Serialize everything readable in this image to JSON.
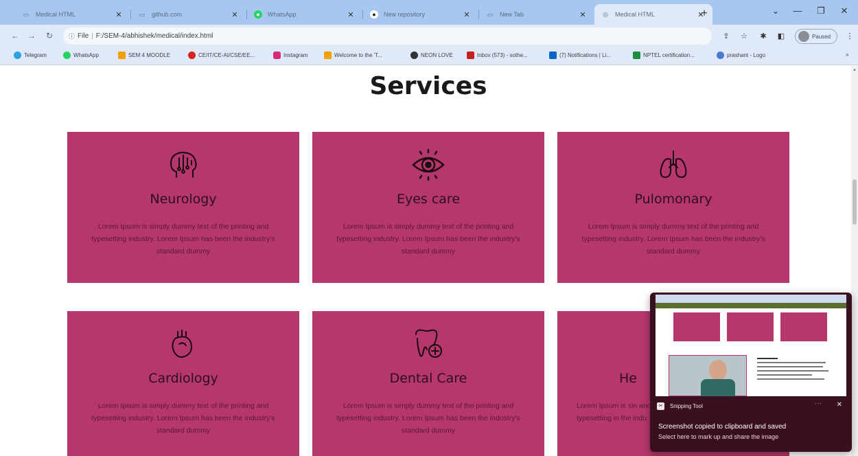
{
  "browser": {
    "tabs": [
      {
        "title": "Medical HTML",
        "favicon": "page-icon",
        "active": false
      },
      {
        "title": "github.com",
        "favicon": "page-icon",
        "active": false
      },
      {
        "title": "WhatsApp",
        "favicon": "whatsapp-icon",
        "active": false
      },
      {
        "title": "New repository",
        "favicon": "github-icon",
        "active": false
      },
      {
        "title": "New Tab",
        "favicon": "page-icon",
        "active": false
      },
      {
        "title": "Medical HTML",
        "favicon": "page-icon",
        "active": true
      }
    ],
    "new_tab_label": "+",
    "address": {
      "scheme_label": "File",
      "url": "F:/SEM-4/abhishek/medical/index.html"
    },
    "profile_label": "Paused",
    "bookmarks": [
      {
        "label": "Telegram",
        "color": "#2aa3df"
      },
      {
        "label": "WhatsApp",
        "color": "#25d366"
      },
      {
        "label": "SEM 4 MOODLE",
        "color": "#f0a000"
      },
      {
        "label": "CE/IT/CE-AI/CSE/EE...",
        "color": "#d9241c"
      },
      {
        "label": "Instagram",
        "color": "#d62976"
      },
      {
        "label": "Welcome to the 'T...",
        "color": "#f0a000"
      },
      {
        "label": "NEON LOVE",
        "color": "#333333"
      },
      {
        "label": "Inbox (573) - sothe...",
        "color": "#c5221f"
      },
      {
        "label": "(7) Notifications | Li...",
        "color": "#0a66c2"
      },
      {
        "label": "NPTEL certification...",
        "color": "#1e8e3e"
      },
      {
        "label": "prashant - Logo",
        "color": "#4a7bd0"
      }
    ]
  },
  "page": {
    "section_title": "Services",
    "services": [
      {
        "title": "Neurology",
        "icon": "brain-icon",
        "text": "Lorem Ipsum is simply dummy text of the printing and typesetting industry. Lorem Ipsum has been the industry's standard dummy"
      },
      {
        "title": "Eyes care",
        "icon": "eye-icon",
        "text": "Lorem Ipsum is simply dummy text of the printing and typesetting industry. Lorem Ipsum has been the industry's standard dummy"
      },
      {
        "title": "Pulomonary",
        "icon": "lungs-icon",
        "text": "Lorem Ipsum is simply dummy text of the printing and typesetting industry. Lorem Ipsum has been the industry's standard dummy"
      },
      {
        "title": "Cardiology",
        "icon": "heart-icon",
        "text": "Lorem Ipsum is simply dummy text of the printing and typesetting industry. Lorem Ipsum has been the industry's standard dummy"
      },
      {
        "title": "Dental Care",
        "icon": "tooth-icon",
        "text": "Lorem Ipsum is simply dummy text of the printing and typesetting industry. Lorem Ipsum has been the industry's standard dummy"
      },
      {
        "title": "He",
        "icon": "",
        "text": "Lorem Ipsum is sin and typesetting in the indu"
      }
    ],
    "card_color": "#b5376b"
  },
  "toast": {
    "app_name": "Snipping Tool",
    "message": "Screenshot copied to clipboard and saved",
    "hint": "Select here to mark up and share the image"
  }
}
